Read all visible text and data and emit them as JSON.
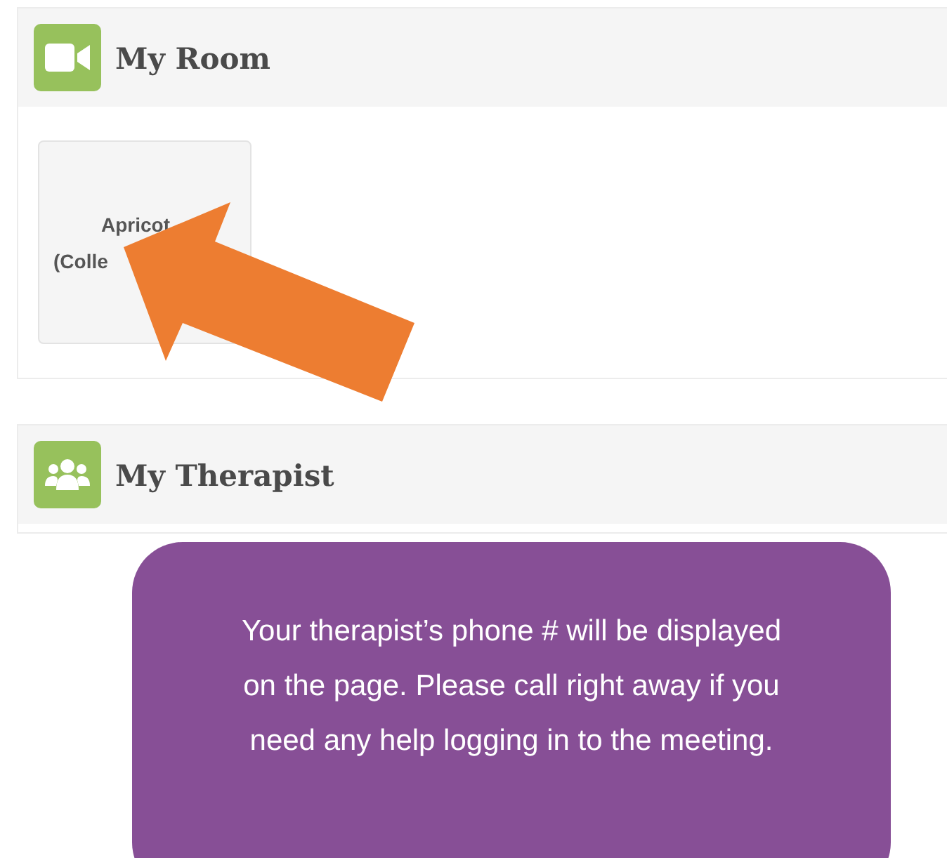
{
  "sections": [
    {
      "title": "My Room",
      "kind": "room",
      "tiles": [
        {
          "lines": [
            "Apricot",
            "(Colle"
          ]
        }
      ]
    },
    {
      "title": "My Therapist",
      "kind": "therapist"
    }
  ],
  "callout": {
    "text": "Your therapist’s phone # will be displayed on the page. Please call right away if you need any help logging in to the meeting."
  },
  "annotation": {
    "kind": "arrow"
  }
}
